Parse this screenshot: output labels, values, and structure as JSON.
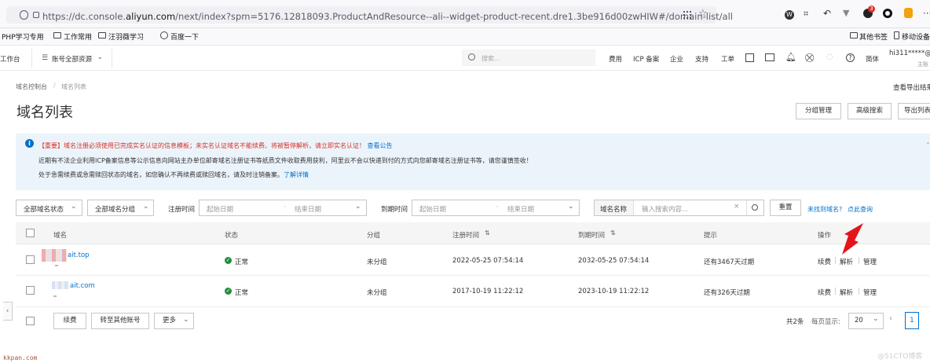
{
  "browser": {
    "url_prefix": "https://dc.console.",
    "url_domain": "aliyun.com",
    "url_suffix": "/next/index?spm=5176.12818093.ProductAndResource--ali--widget-product-recent.dre1.3be916d00zwHIW#/domain-list/all",
    "bookmarks": [
      "PHP学习专用",
      "工作常用",
      "汪羽薇学习",
      "百度一下"
    ],
    "bookmarks_right": [
      "其他书签",
      "移动设备"
    ]
  },
  "topnav": {
    "workbench": "工作台",
    "account_resources": "账号全部资源",
    "search_placeholder": "搜索...",
    "links": [
      "费用",
      "ICP 备案",
      "企业",
      "支持",
      "工单"
    ],
    "lang": "简体",
    "user": "hi311*****@",
    "user_sub": "主账",
    "badge_count": "3"
  },
  "breadcrumb": [
    "域名控制台",
    "域名列表"
  ],
  "view_export": "查看导出结果",
  "page_title": "域名列表",
  "header_buttons": [
    "分组管理",
    "高级搜索",
    "导出列表"
  ],
  "notice": {
    "line1_tag": "【重要】",
    "line1_text": "域名注册必须使用已完成实名认证的信息模板；未实名认证域名不能续费、将被暂停解析，请立即实名认证！",
    "line1_link": "查看公告",
    "line2": "近期有不法企业利用ICP备案信息等公示信息向网站主办单位邮寄域名注册证书等纸质文件收取费用获利，阿里云不会以快递到付的方式向您邮寄域名注册证书等，请您谨慎签收！",
    "line3": "处于急需续费或急需赎回状态的域名，如您确认不再续费或赎回域名，请及时注销备案。",
    "line3_link": "了解详情"
  },
  "filters": {
    "status": "全部域名状态",
    "group": "全部域名分组",
    "reg_time_label": "注册时间",
    "expire_time_label": "到期时间",
    "start_date": "起始日期",
    "end_date": "结束日期",
    "name_label": "域名名称",
    "search_placeholder": "输入搜索内容...",
    "reset": "重置",
    "not_found": "未找到域名?",
    "query_link": "点此查询"
  },
  "table": {
    "headers": [
      "域名",
      "状态",
      "分组",
      "注册时间",
      "到期时间",
      "提示",
      "操作"
    ],
    "rows": [
      {
        "domain": "ait.top",
        "status": "正常",
        "group": "未分组",
        "reg": "2022-05-25 07:54:14",
        "exp": "2032-05-25 07:54:14",
        "tip": "还有3467天过期",
        "actions": [
          "续费",
          "解析",
          "管理"
        ]
      },
      {
        "domain": "ait.com",
        "status": "正常",
        "group": "未分组",
        "reg": "2017-10-19 11:22:12",
        "exp": "2023-10-19 11:22:12",
        "tip": "还有326天过期",
        "actions": [
          "续费",
          "解析",
          "管理"
        ]
      }
    ]
  },
  "footer": {
    "buttons": [
      "续费",
      "转至其他账号",
      "更多"
    ],
    "total": "共2条",
    "per_page_label": "每页显示:",
    "per_page": "20",
    "page": "1"
  },
  "watermark": "kkpan.com",
  "watermark_right": "@51CTO博客",
  "colors": {
    "accent": "#0070cc",
    "danger": "#d93026",
    "success": "#1e8e3e",
    "notice_bg": "#ecf4fb",
    "arrow": "#e4141b"
  }
}
